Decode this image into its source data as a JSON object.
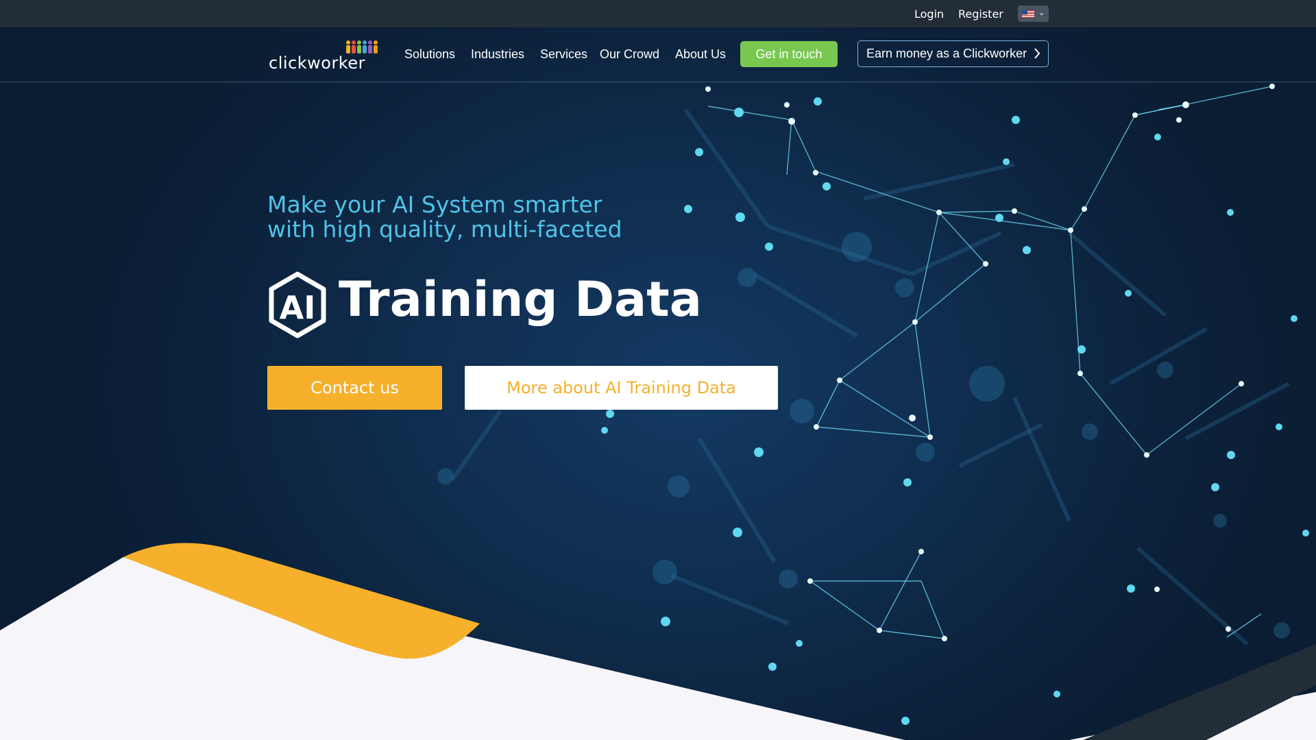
{
  "topbar": {
    "login": "Login",
    "register": "Register",
    "language": "us-flag-icon"
  },
  "nav": {
    "logo_text": "clickworker",
    "items": [
      {
        "label": "Solutions"
      },
      {
        "label": "Industries"
      },
      {
        "label": "Services"
      },
      {
        "label": "Our Crowd"
      },
      {
        "label": "About Us"
      }
    ],
    "cta_touch": "Get in touch",
    "cta_earn": "Earn money as a Clickworker"
  },
  "hero": {
    "tagline_line1": "Make your AI System smarter",
    "tagline_line2": "with high quality, multi-faceted",
    "badge": "AI",
    "headline": "Training Data",
    "contact_button": "Contact us",
    "more_button": "More about AI Training Data"
  },
  "colors": {
    "topbar_bg": "#222d38",
    "hero_bg": "#0f2d4e",
    "accent_green": "#78c850",
    "accent_orange": "#f6b02c",
    "tagline_cyan": "#4fc3e8",
    "network_cyan": "#5fd8f0"
  }
}
